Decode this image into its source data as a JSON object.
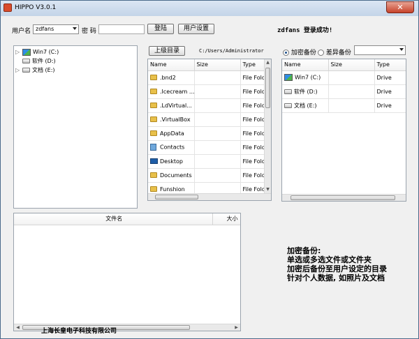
{
  "window": {
    "title": "HIPPO  V3.0.1",
    "close_glyph": "✕"
  },
  "login": {
    "username_label": "用户名",
    "username_value": "zdfans",
    "password_label": "密 码",
    "password_value": "",
    "login_button": "登陆",
    "settings_button": "用户设置",
    "status_message": "zdfans 登录成功!"
  },
  "left_tree": {
    "items": [
      {
        "label": "Win7 (C:)",
        "icon": "windows-drive-icon",
        "expander": "▷"
      },
      {
        "label": "软件 (D:)",
        "icon": "drive-icon",
        "expander": ""
      },
      {
        "label": "文档 (E:)",
        "icon": "drive-icon",
        "expander": "▷"
      }
    ]
  },
  "middle": {
    "up_button": "上级目录",
    "path": "C:/Users/Administrator",
    "columns": [
      "Name",
      "Size",
      "Type"
    ],
    "rows": [
      {
        "name": ".bnd2",
        "size": "",
        "type": "File Folder",
        "icon": "folder-icon"
      },
      {
        "name": ".Icecream ...",
        "size": "",
        "type": "File Folder",
        "icon": "folder-icon"
      },
      {
        "name": ".LdVirtual...",
        "size": "",
        "type": "File Folder",
        "icon": "folder-icon"
      },
      {
        "name": ".VirtualBox",
        "size": "",
        "type": "File Folder",
        "icon": "folder-icon"
      },
      {
        "name": "AppData",
        "size": "",
        "type": "File Folder",
        "icon": "folder-icon"
      },
      {
        "name": "Contacts",
        "size": "",
        "type": "File Folder",
        "icon": "contacts-icon"
      },
      {
        "name": "Desktop",
        "size": "",
        "type": "File Folder",
        "icon": "desktop-icon"
      },
      {
        "name": "Documents",
        "size": "",
        "type": "File Folder",
        "icon": "folder-icon"
      },
      {
        "name": "Funshion",
        "size": "",
        "type": "File Folder",
        "icon": "folder-icon"
      }
    ]
  },
  "right": {
    "radio_encrypt": "加密备份",
    "radio_diff": "差异备份",
    "select_value": "",
    "columns": [
      "Name",
      "Size",
      "Type"
    ],
    "rows": [
      {
        "name": "Win7 (C:)",
        "size": "",
        "type": "Drive",
        "icon": "windows-drive-icon"
      },
      {
        "name": "软件 (D:)",
        "size": "",
        "type": "Drive",
        "icon": "drive-icon"
      },
      {
        "name": "文档 (E:)",
        "size": "",
        "type": "Drive",
        "icon": "drive-icon"
      }
    ]
  },
  "bottom_list": {
    "col_filename": "文件名",
    "col_size": "大小"
  },
  "info": {
    "lines": [
      "加密备份:",
      "单选或多选文件或文件夹",
      "加密后备份至用户设定的目录",
      "针对个人数据, 如照片及文档"
    ]
  },
  "footer": {
    "company": "上海长皇电子科技有限公司"
  }
}
